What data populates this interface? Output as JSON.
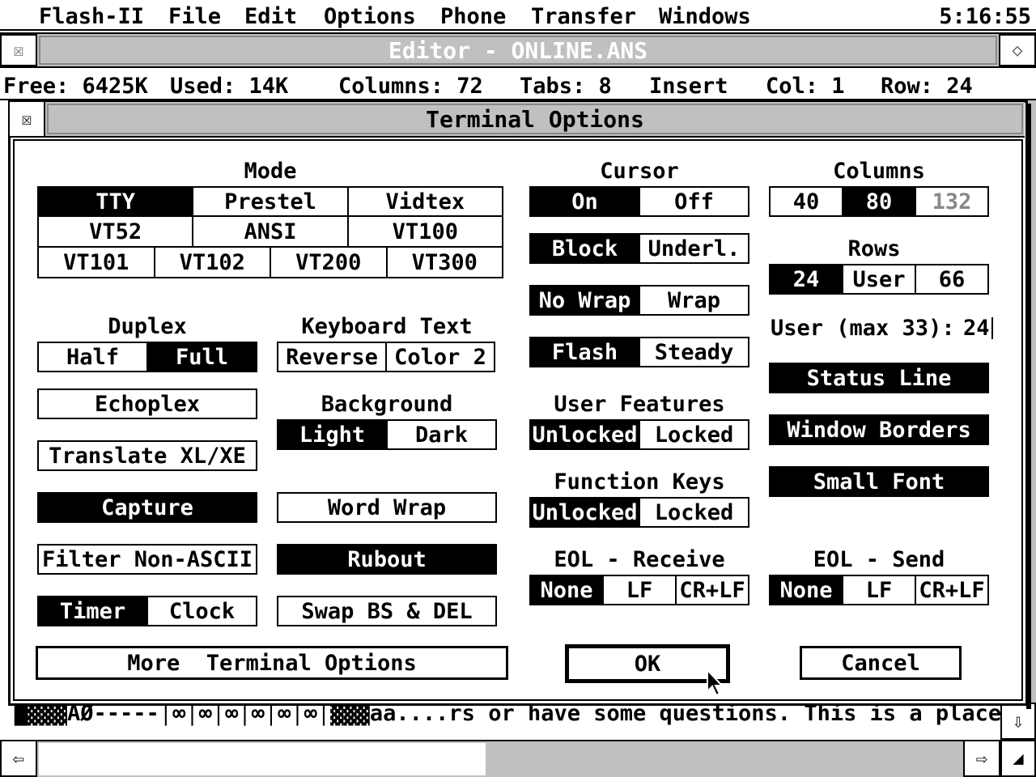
{
  "menubar": {
    "items": [
      "Flash-II",
      "File",
      "Edit",
      "Options",
      "Phone",
      "Transfer",
      "Windows"
    ],
    "clock": "5:16:55"
  },
  "editor": {
    "title": "Editor - ONLINE.ANS",
    "status": {
      "free": "Free: 6425K",
      "used": "Used: 14K",
      "columns": "Columns: 72",
      "tabs": "Tabs: 8",
      "mode": "Insert",
      "col": "Col: 1",
      "row": "Row: 24"
    },
    "text_line": "█▓▓▓AØ-----│∞│∞│∞│∞│∞│∞│▓▓▓aa....rs or have some questions.  This is a place",
    "icons": {
      "close": "close-icon",
      "fuller": "fuller-icon",
      "down": "arrow-down-icon",
      "left": "arrow-left-icon",
      "right": "arrow-right-icon",
      "size": "sizer-icon"
    }
  },
  "dialog": {
    "title": "Terminal Options",
    "mode": {
      "label": "Mode",
      "row1": [
        "TTY",
        "Prestel",
        "Vidtex"
      ],
      "row2": [
        "VT52",
        "ANSI",
        "VT100"
      ],
      "row3": [
        "VT101",
        "VT102",
        "VT200",
        "VT300"
      ],
      "selected": "TTY"
    },
    "duplex": {
      "label": "Duplex",
      "options": [
        "Half",
        "Full"
      ],
      "selected": "Full"
    },
    "keyboard_text": {
      "label": "Keyboard Text",
      "options": [
        "Reverse",
        "Color 2"
      ]
    },
    "echoplex": "Echoplex",
    "translate": "Translate XL/XE",
    "background": {
      "label": "Background",
      "options": [
        "Light",
        "Dark"
      ],
      "selected": "Light"
    },
    "capture": "Capture",
    "word_wrap": "Word Wrap",
    "filter": "Filter Non-ASCII",
    "rubout": "Rubout",
    "timer": {
      "options": [
        "Timer",
        "Clock"
      ],
      "selected": "Timer"
    },
    "swap": "Swap BS & DEL",
    "cursor": {
      "label": "Cursor",
      "state": {
        "options": [
          "On",
          "Off"
        ],
        "selected": "On"
      },
      "shape": {
        "options": [
          "Block",
          "Underl."
        ],
        "selected": "Block"
      },
      "wrap": {
        "options": [
          "No Wrap",
          "Wrap"
        ],
        "selected": "No Wrap"
      },
      "blink": {
        "options": [
          "Flash",
          "Steady"
        ],
        "selected": "Flash"
      }
    },
    "user_features": {
      "label": "User Features",
      "options": [
        "Unlocked",
        "Locked"
      ],
      "selected": "Unlocked"
    },
    "function_keys": {
      "label": "Function Keys",
      "options": [
        "Unlocked",
        "Locked"
      ],
      "selected": "Unlocked"
    },
    "eol_receive": {
      "label": "EOL - Receive",
      "options": [
        "None",
        "LF",
        "CR+LF"
      ],
      "selected": "None"
    },
    "columns": {
      "label": "Columns",
      "options": [
        "40",
        "80",
        "132"
      ],
      "selected": "80",
      "disabled": "132"
    },
    "rows": {
      "label": "Rows",
      "options": [
        "24",
        "User",
        "66"
      ],
      "selected": "24"
    },
    "user_rows": {
      "label": "User (max 33):",
      "value": "24"
    },
    "status_line": "Status Line",
    "window_borders": "Window Borders",
    "small_font": "Small Font",
    "eol_send": {
      "label": "EOL - Send",
      "options": [
        "None",
        "LF",
        "CR+LF"
      ],
      "selected": "None"
    },
    "more": "More  Terminal Options",
    "ok": "OK",
    "cancel": "Cancel"
  }
}
